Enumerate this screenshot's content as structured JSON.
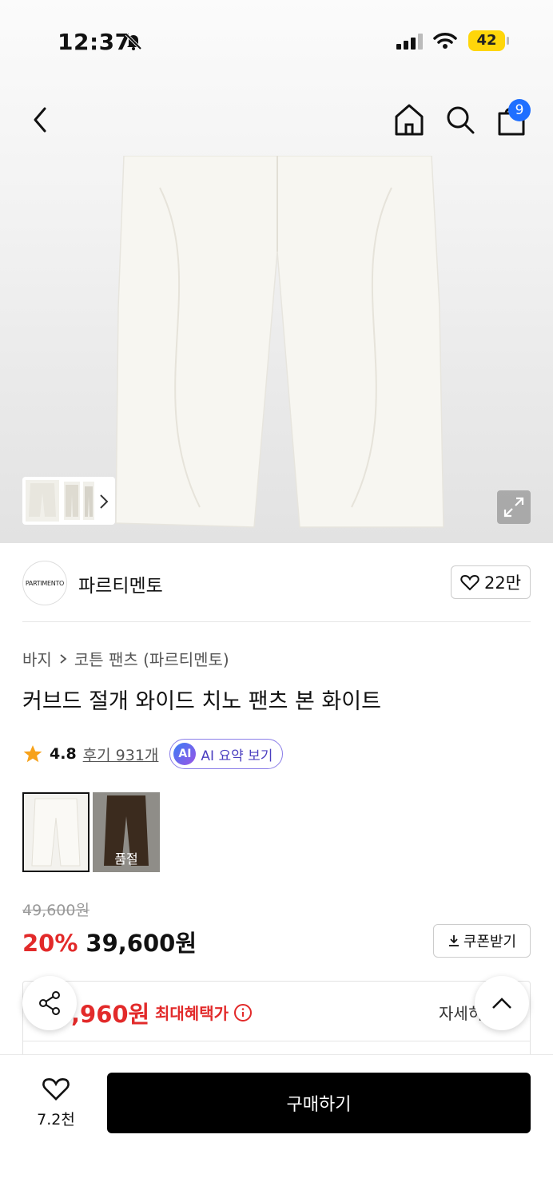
{
  "status_bar": {
    "time": "12:37",
    "battery": "42"
  },
  "nav": {
    "cart_count": "9"
  },
  "brand": {
    "logo_text": "PARTIMENTO",
    "name": "파르티멘토",
    "likes": "22만"
  },
  "breadcrumb": [
    "바지",
    "코튼 팬츠 (파르티멘토)"
  ],
  "product": {
    "title": "커브드 절개 와이드 치노 팬츠 본 화이트",
    "rating": "4.8",
    "reviews": "후기 931개",
    "ai_badge": "AI",
    "ai_summary": "AI 요약 보기"
  },
  "colors": [
    {
      "name": "white",
      "color": "#f3f2ee",
      "soldout": ""
    },
    {
      "name": "brown",
      "color": "#3b2b1e",
      "soldout": "품절"
    }
  ],
  "price": {
    "original": "49,600원",
    "discount": "20%",
    "sale": "39,600원",
    "coupon": "쿠폰받기"
  },
  "benefit": {
    "price": ",960원",
    "label": "최대혜택가",
    "detail": "자세히"
  },
  "bottom": {
    "wish_count": "7.2천",
    "buy": "구매하기"
  },
  "accent": {
    "discount_red": "#e22a2a",
    "badge_blue": "#1f6fff"
  }
}
